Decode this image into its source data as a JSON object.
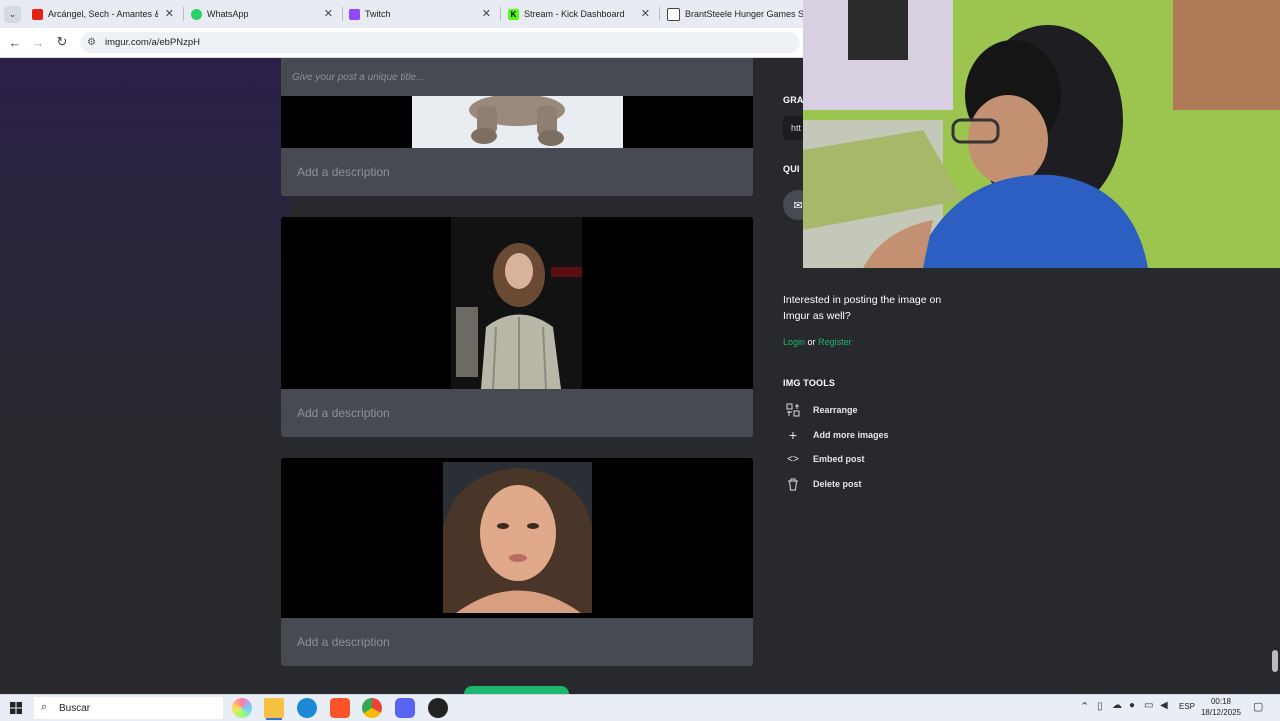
{
  "browser": {
    "tabs": [
      {
        "title": "Arcángel, Sech - Amantes & An",
        "icon": "youtube-icon",
        "color": "#e62117"
      },
      {
        "title": "WhatsApp",
        "icon": "whatsapp-icon",
        "color": "#25d366"
      },
      {
        "title": "Twitch",
        "icon": "twitch-icon",
        "color": "#9146ff"
      },
      {
        "title": "Stream - Kick Dashboard",
        "icon": "kick-icon",
        "color": "#53fc18"
      },
      {
        "title": "BrantSteele Hunger Games Sim",
        "icon": "brantsteele-icon",
        "color": "#444444"
      }
    ],
    "url": "imgur.com/a/ebPNzpH"
  },
  "post": {
    "title_placeholder": "Give your post a unique title...",
    "description_placeholder": "Add a description"
  },
  "sidebar": {
    "graph_heading": "GRA",
    "graph_value": "htt",
    "quick_heading": "QUI",
    "interest_text": "Interested in posting the image on Imgur as well?",
    "login_label": "Login",
    "or_label": "or",
    "register_label": "Register",
    "tools_heading": "IMG TOOLS",
    "tools": [
      {
        "label": "Rearrange",
        "icon": "rearrange-icon"
      },
      {
        "label": "Add more images",
        "icon": "plus-icon"
      },
      {
        "label": "Embed post",
        "icon": "embed-icon"
      },
      {
        "label": "Delete post",
        "icon": "trash-icon"
      }
    ]
  },
  "taskbar": {
    "search_placeholder": "Buscar",
    "language": "ESP",
    "time": "00:18",
    "date": "18/12/2025"
  },
  "colors": {
    "accent_green": "#1bb76e",
    "page_bg": "#27292d",
    "card_bg": "#474a51"
  }
}
